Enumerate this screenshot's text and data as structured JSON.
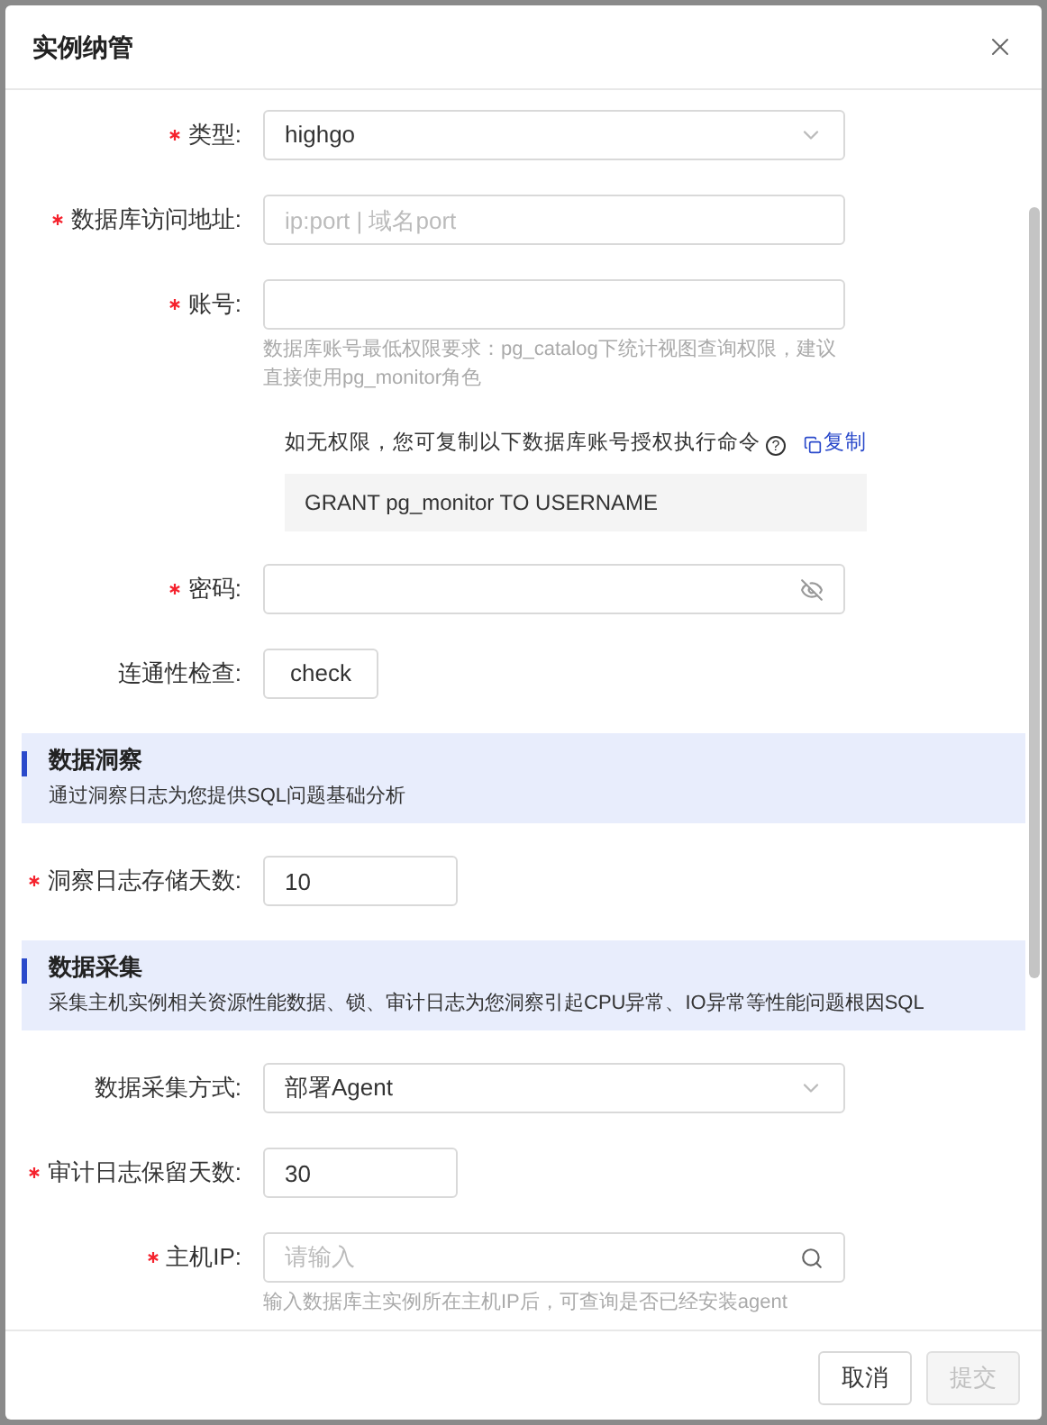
{
  "dialog": {
    "title": "实例纳管"
  },
  "items": [
    {
      "kind": "select",
      "label": "类型:",
      "required": true,
      "value": "highgo"
    },
    {
      "kind": "text",
      "label": "数据库访问地址:",
      "required": true,
      "placeholder": "ip:port | 域名port"
    },
    {
      "kind": "text",
      "label": "账号:",
      "required": true,
      "hint": "数据库账号最低权限要求：pg_catalog下统计视图查询权限，建议直接使用pg_monitor角色"
    },
    {
      "kind": "command",
      "note": "如无权限，您可复制以下数据库账号授权执行命令",
      "help": "?",
      "copy": "复制",
      "command": "GRANT pg_monitor TO USERNAME"
    },
    {
      "kind": "password",
      "label": "密码:",
      "required": true
    },
    {
      "kind": "button",
      "label": "连通性检查:",
      "required": false,
      "button": "check"
    },
    {
      "kind": "banner",
      "title": "数据洞察",
      "description": "通过洞察日志为您提供SQL问题基础分析"
    },
    {
      "kind": "number",
      "label": "洞察日志存储天数:",
      "required": true,
      "value": "10"
    },
    {
      "kind": "banner",
      "title": "数据采集",
      "description": "采集主机实例相关资源性能数据、锁、审计日志为您洞察引起CPU异常、IO异常等性能问题根因SQL"
    },
    {
      "kind": "select",
      "label": "数据采集方式:",
      "required": false,
      "value": "部署Agent"
    },
    {
      "kind": "number",
      "label": "审计日志保留天数:",
      "required": true,
      "value": "30"
    },
    {
      "kind": "search",
      "label": "主机IP:",
      "required": true,
      "placeholder": "请输入",
      "hint": "输入数据库主实例所在主机IP后，可查询是否已经安装agent"
    }
  ],
  "footer": [
    {
      "label": "取消",
      "disabled": false
    },
    {
      "label": "提交",
      "disabled": true
    }
  ]
}
